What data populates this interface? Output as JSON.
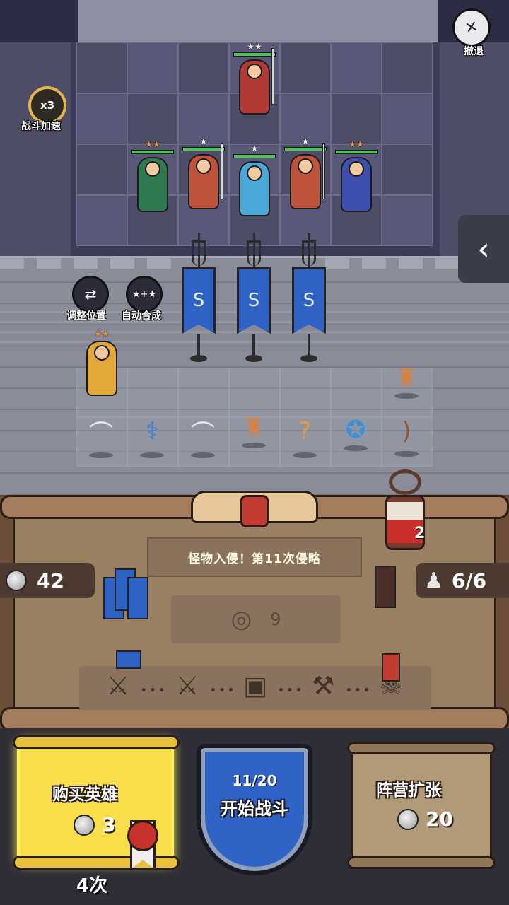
{
  "top_controls": {
    "speed_multiplier": "x3",
    "speed_label": "战斗加速",
    "retreat_label": "撤退",
    "side_toggle_icon": "chevron-left-icon"
  },
  "bench_controls": {
    "adjust_label": "调整位置",
    "auto_merge_label": "自动合成"
  },
  "units": [
    {
      "name": "shield-warrior",
      "stars": "★★",
      "star_color": "#f3f3f3",
      "hp": 1.0,
      "body_color": "#b23a34"
    },
    {
      "name": "rifleman",
      "stars": "★★",
      "star_color": "#f0963a",
      "hp": 1.0,
      "body_color": "#2e7a4e"
    },
    {
      "name": "spearman-1",
      "stars": "★",
      "star_color": "#f3f3f3",
      "hp": 1.0,
      "body_color": "#c0533c"
    },
    {
      "name": "mage",
      "stars": "★",
      "star_color": "#f3f3f3",
      "hp": 1.0,
      "body_color": "#4aa9d8"
    },
    {
      "name": "spearman-2",
      "stars": "★",
      "star_color": "#f3f3f3",
      "hp": 1.0,
      "body_color": "#c0533c"
    },
    {
      "name": "strategist",
      "stars": "★★",
      "star_color": "#f0963a",
      "hp": 1.0,
      "body_color": "#3f4fb0"
    },
    {
      "name": "bench-hero",
      "stars": "★★",
      "star_color": "#f0963a",
      "body_color": "#e2a83a"
    }
  ],
  "items": [
    "bow-icon",
    "staff-icon",
    "bow-icon",
    "armor-icon",
    "cane-icon",
    "book-icon",
    "longbow-icon",
    "armor-icon"
  ],
  "wave": {
    "title": "怪物入侵！第11次侵略",
    "reward": "9",
    "hourglass_count": "2"
  },
  "resources": {
    "coins": "42",
    "population": "6/6"
  },
  "actions": {
    "buy_hero_label": "购买英雄",
    "buy_hero_price": "3",
    "buy_hero_times": "4次",
    "battle_count": "11/20",
    "start_battle_label": "开始战斗",
    "expand_label": "阵营扩张",
    "expand_price": "20"
  },
  "colors": {
    "ally_banner": "#2f62c5",
    "enemy_banner": "#c23a32",
    "hp_bar": "#49c85a",
    "buy_card": "#f7de4a"
  }
}
